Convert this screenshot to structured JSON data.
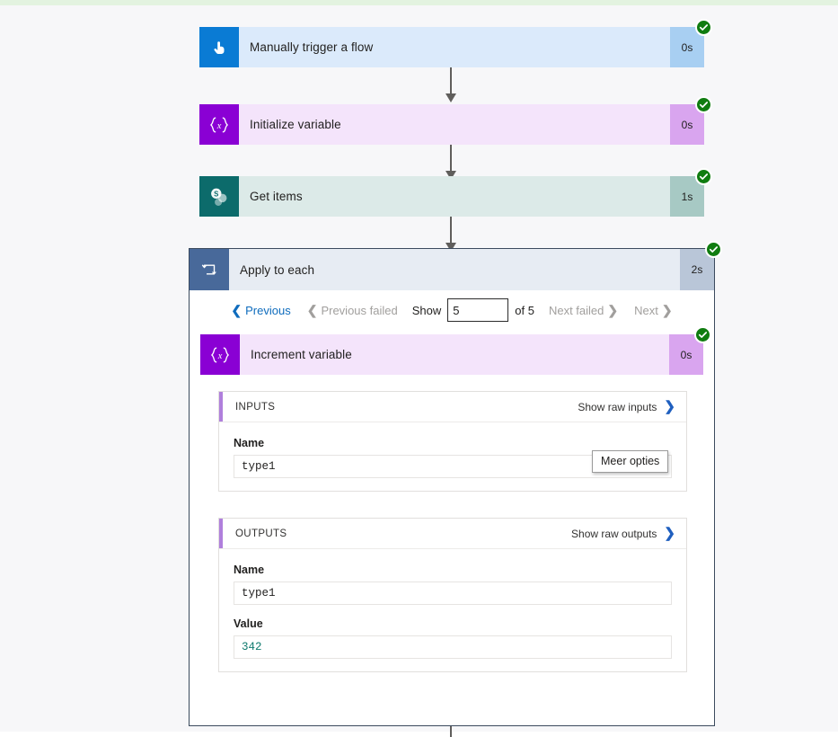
{
  "flow": {
    "steps": [
      {
        "name": "Manually trigger a flow",
        "duration": "0s",
        "status": "succeeded",
        "icon": "tap-finger-icon",
        "icon_glyph": "☝"
      },
      {
        "name": "Initialize variable",
        "duration": "0s",
        "status": "succeeded",
        "icon": "variable-braces-icon",
        "icon_glyph": "{x}"
      },
      {
        "name": "Get items",
        "duration": "1s",
        "status": "succeeded",
        "icon": "sharepoint-icon",
        "icon_glyph": "S"
      }
    ],
    "scope": {
      "name": "Apply to each",
      "duration": "2s",
      "status": "succeeded",
      "icon": "loop-icon",
      "pager": {
        "previous": "Previous",
        "previous_failed": "Previous failed",
        "show_label": "Show",
        "show_value": "5",
        "of_label": "of 5",
        "next_failed": "Next failed",
        "next": "Next"
      },
      "inner_step": {
        "name": "Increment variable",
        "duration": "0s",
        "status": "succeeded",
        "icon": "variable-braces-icon",
        "icon_glyph": "{x}"
      },
      "inputs": {
        "title": "INPUTS",
        "raw_link": "Show raw inputs",
        "fields": [
          {
            "label": "Name",
            "value": "type1"
          }
        ]
      },
      "outputs": {
        "title": "OUTPUTS",
        "raw_link": "Show raw outputs",
        "fields": [
          {
            "label": "Name",
            "value": "type1"
          },
          {
            "label": "Value",
            "value": "342"
          }
        ]
      }
    }
  },
  "tooltip": {
    "text": "Meer opties"
  },
  "colors": {
    "accent_blue": "#0f6cbd",
    "success_green": "#107c10",
    "variable_purple": "#8a00d4",
    "sharepoint_teal": "#0c6b6b",
    "loop_slate": "#48699a",
    "value_teal": "#0f7a6e"
  }
}
